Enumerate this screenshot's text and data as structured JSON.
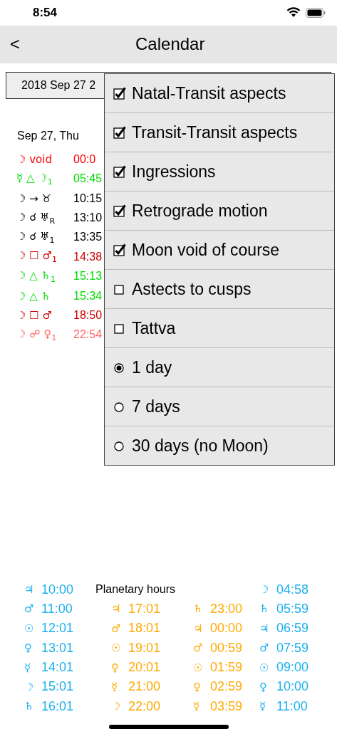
{
  "status_bar": {
    "time": "8:54"
  },
  "nav": {
    "back": "<",
    "title": "Calendar"
  },
  "date_field": {
    "value": "2018 Sep 27 2"
  },
  "day": {
    "heading": "Sep 27, Thu",
    "events": [
      {
        "aspect": "☽ void",
        "time": "00:0",
        "color": "#ff0000"
      },
      {
        "aspect": "☿ △ ☽$_{1}$",
        "time": "05:45",
        "color": "#00dd00"
      },
      {
        "aspect": "☽ → ♉",
        "time": "10:15",
        "color": "#000000"
      },
      {
        "aspect": "☽ ☌ ♅$_{R}$",
        "time": "13:10",
        "color": "#000000"
      },
      {
        "aspect": "☽ ☌ ♅$_{1}$",
        "time": "13:35",
        "color": "#000000"
      },
      {
        "aspect": "☽ ☐ ♂$_{1}$",
        "time": "14:38",
        "color": "#d00000"
      },
      {
        "aspect": "☽ △ ♄$_{1}$",
        "time": "15:13",
        "color": "#00dd00"
      },
      {
        "aspect": "☽ △ ♄",
        "time": "15:34",
        "color": "#00dd00"
      },
      {
        "aspect": "☽ ☐ ♂",
        "time": "18:50",
        "color": "#d00000"
      },
      {
        "aspect": "☽ ☍ ♀$_{1}$",
        "time": "22:54",
        "color": "#ff6666"
      }
    ]
  },
  "menu": {
    "items": [
      {
        "kind": "checkbox",
        "label": "Natal-Transit aspects",
        "checked": true
      },
      {
        "kind": "checkbox",
        "label": "Transit-Transit aspects",
        "checked": true
      },
      {
        "kind": "checkbox",
        "label": "Ingressions",
        "checked": true
      },
      {
        "kind": "checkbox",
        "label": "Retrograde motion",
        "checked": true
      },
      {
        "kind": "checkbox",
        "label": "Moon void of course",
        "checked": true
      },
      {
        "kind": "checkbox",
        "label": "Astects to cusps",
        "checked": false
      },
      {
        "kind": "checkbox",
        "label": "Tattva",
        "checked": false
      },
      {
        "kind": "radio",
        "label": "1 day",
        "selected": true
      },
      {
        "kind": "radio",
        "label": "7 days",
        "selected": false
      },
      {
        "kind": "radio",
        "label": "30 days (no Moon)",
        "selected": false
      }
    ]
  },
  "planetary_hours": {
    "title": "Planetary hours",
    "columns": [
      {
        "color": "#1ab0f0",
        "hours": [
          {
            "planet": "♃",
            "time": "10:00"
          },
          {
            "planet": "♂",
            "time": "11:00"
          },
          {
            "planet": "☉",
            "time": "12:01"
          },
          {
            "planet": "♀",
            "time": "13:01"
          },
          {
            "planet": "☿",
            "time": "14:01"
          },
          {
            "planet": "☽",
            "time": "15:01"
          },
          {
            "planet": "♄",
            "time": "16:01"
          }
        ]
      },
      {
        "color": "#ffaa00",
        "hours": [
          {
            "planet": "♃",
            "time": "17:01"
          },
          {
            "planet": "♂",
            "time": "18:01"
          },
          {
            "planet": "☉",
            "time": "19:01"
          },
          {
            "planet": "♀",
            "time": "20:01"
          },
          {
            "planet": "☿",
            "time": "21:00"
          },
          {
            "planet": "☽",
            "time": "22:00"
          }
        ]
      },
      {
        "color": "#ffaa00",
        "hours": [
          {
            "planet": "♄",
            "time": "23:00"
          },
          {
            "planet": "♃",
            "time": "00:00"
          },
          {
            "planet": "♂",
            "time": "00:59"
          },
          {
            "planet": "☉",
            "time": "01:59"
          },
          {
            "planet": "♀",
            "time": "02:59"
          },
          {
            "planet": "☿",
            "time": "03:59"
          }
        ]
      },
      {
        "color": "#1ab0f0",
        "hours": [
          {
            "planet": "☽",
            "time": "04:58"
          },
          {
            "planet": "♄",
            "time": "05:59"
          },
          {
            "planet": "♃",
            "time": "06:59"
          },
          {
            "planet": "♂",
            "time": "07:59"
          },
          {
            "planet": "☉",
            "time": "09:00"
          },
          {
            "planet": "♀",
            "time": "10:00"
          },
          {
            "planet": "☿",
            "time": "11:00"
          }
        ]
      }
    ]
  }
}
